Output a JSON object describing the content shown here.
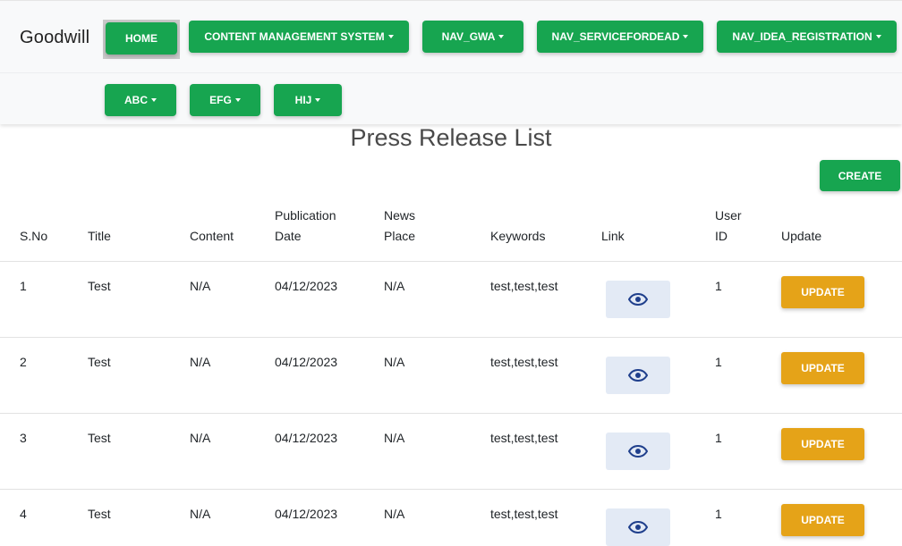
{
  "brand": "Goodwill",
  "nav": {
    "home": "HOME",
    "cms": "CONTENT MANAGEMENT SYSTEM",
    "gwa": "NAV_GWA",
    "service": "NAV_SERVICEFORDEAD",
    "idea": "NAV_IDEA_REGISTRATION",
    "abc": "ABC",
    "efg": "EFG",
    "hij": "HIJ"
  },
  "page_title": "Press Release List",
  "create_label": "CREATE",
  "table": {
    "headers": {
      "sno": "S.No",
      "title": "Title",
      "content": "Content",
      "pub_line1": "Publication",
      "pub_line2": "Date",
      "place_line1": "News",
      "place_line2": "Place",
      "keywords": "Keywords",
      "link": "Link",
      "user_line1": "User",
      "user_line2": "ID",
      "update": "Update"
    },
    "rows": [
      {
        "sno": "1",
        "title": "Test",
        "content": "N/A",
        "date": "04/12/2023",
        "place": "N/A",
        "keywords": "test,test,test",
        "user_id": "1",
        "update": "UPDATE"
      },
      {
        "sno": "2",
        "title": "Test",
        "content": "N/A",
        "date": "04/12/2023",
        "place": "N/A",
        "keywords": "test,test,test",
        "user_id": "1",
        "update": "UPDATE"
      },
      {
        "sno": "3",
        "title": "Test",
        "content": "N/A",
        "date": "04/12/2023",
        "place": "N/A",
        "keywords": "test,test,test",
        "user_id": "1",
        "update": "UPDATE"
      },
      {
        "sno": "4",
        "title": "Test",
        "content": "N/A",
        "date": "04/12/2023",
        "place": "N/A",
        "keywords": "test,test,test",
        "user_id": "1",
        "update": "UPDATE"
      }
    ]
  },
  "colors": {
    "nav_green": "#17a550",
    "update_orange": "#e5a318",
    "eye_button_bg": "#e3eaf5",
    "eye_icon": "#1f3f8c"
  },
  "icons": {
    "link": "eye-icon"
  }
}
